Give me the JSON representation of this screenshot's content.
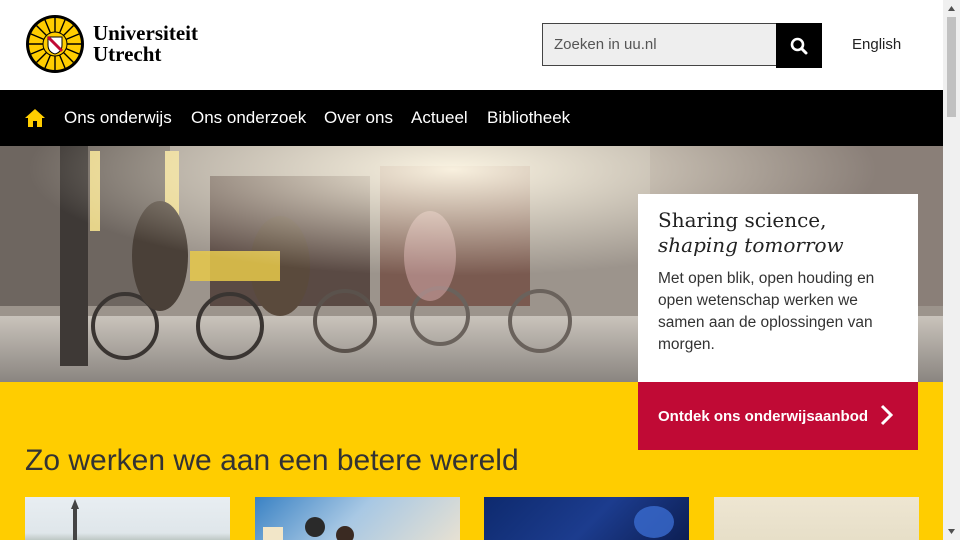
{
  "header": {
    "logo_line1": "Universiteit",
    "logo_line2": "Utrecht",
    "search_placeholder": "Zoeken in uu.nl",
    "language_link": "English"
  },
  "nav": {
    "items": [
      {
        "label": "Ons onderwijs"
      },
      {
        "label": "Ons onderzoek"
      },
      {
        "label": "Over ons"
      },
      {
        "label": "Actueel"
      },
      {
        "label": "Bibliotheek"
      }
    ]
  },
  "hero": {
    "title_line1": "Sharing science,",
    "title_line2": "shaping tomorrow",
    "text": "Met open blik, open houding en open wetenschap werken we samen aan de oplossingen van morgen.",
    "cta_label": "Ontdek ons onderwijsaanbod"
  },
  "section": {
    "title": "Zo werken we aan een betere wereld"
  },
  "colors": {
    "brand_yellow": "#ffcd00",
    "brand_red": "#c00a35",
    "nav_black": "#000000"
  },
  "icons": {
    "search": "search-icon",
    "home": "home-icon",
    "arrow": "chevron-right-icon"
  }
}
